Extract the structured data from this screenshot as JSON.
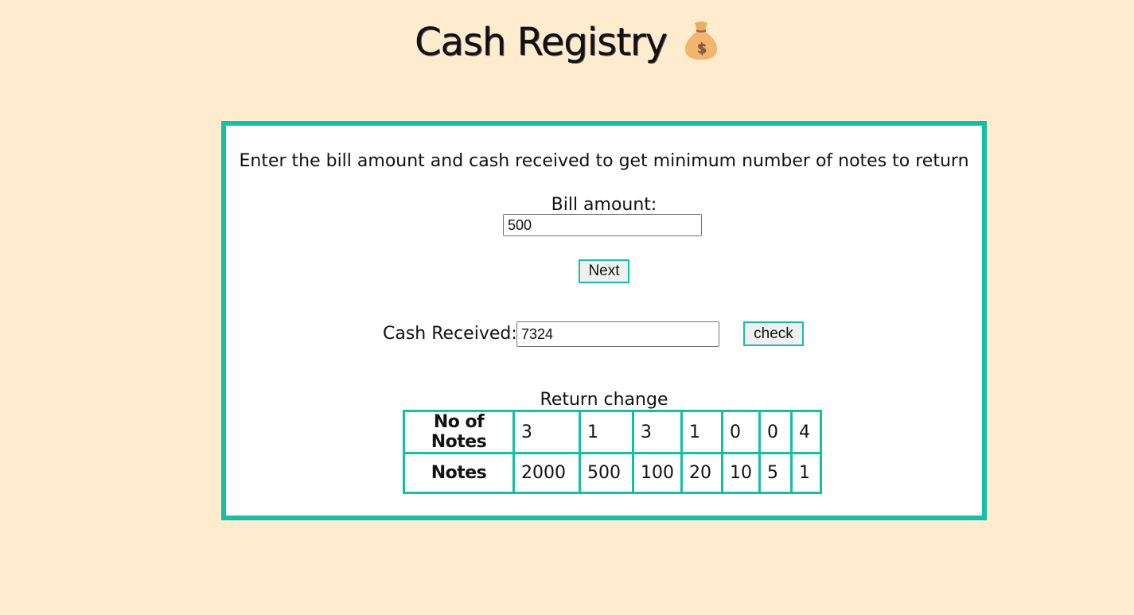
{
  "header": {
    "title": "Cash Registry"
  },
  "form": {
    "instructions": "Enter the bill amount and cash received to get minimum number of notes to return",
    "bill_label": "Bill amount:",
    "bill_value": "500",
    "next_label": "Next",
    "cash_label": "Cash Received:",
    "cash_value": "7324",
    "check_label": "check"
  },
  "result": {
    "title": "Return change",
    "row_labels": {
      "count": "No of Notes",
      "notes": "Notes"
    },
    "counts": [
      "3",
      "1",
      "3",
      "1",
      "0",
      "0",
      "4"
    ],
    "notes": [
      "2000",
      "500",
      "100",
      "20",
      "10",
      "5",
      "1"
    ]
  },
  "colors": {
    "background": "#ffebcd",
    "accent": "#13bfa6",
    "card": "#ffffff"
  },
  "icons": {
    "title_icon": "money-bag-icon"
  }
}
